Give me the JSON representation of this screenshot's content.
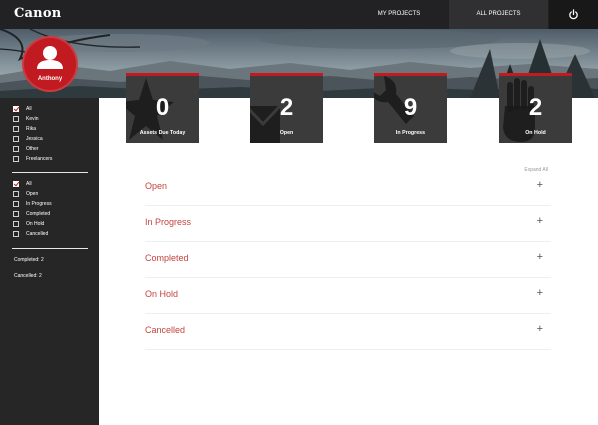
{
  "header": {
    "logo": "Canon",
    "nav": {
      "my_projects": "MY PROJECTS",
      "all_projects": "ALL PROJECTS"
    },
    "power_icon": "power-icon"
  },
  "user": {
    "name": "Anthony"
  },
  "sidebar": {
    "people_filters": [
      {
        "label": "All",
        "checked": true
      },
      {
        "label": "Kevin",
        "checked": false
      },
      {
        "label": "Rika",
        "checked": false
      },
      {
        "label": "Jessica",
        "checked": false
      },
      {
        "label": "Other",
        "checked": false
      },
      {
        "label": "Freelancers",
        "checked": false
      }
    ],
    "status_filters": [
      {
        "label": "All",
        "checked": true
      },
      {
        "label": "Open",
        "checked": false
      },
      {
        "label": "In Progress",
        "checked": false
      },
      {
        "label": "Completed",
        "checked": false
      },
      {
        "label": "On Hold",
        "checked": false
      },
      {
        "label": "Cancelled",
        "checked": false
      }
    ],
    "summary": {
      "completed": "Completed: 2",
      "cancelled": "Cancelled: 2"
    }
  },
  "stats": [
    {
      "value": "0",
      "label": "Assets Due Today",
      "icon": "star-icon"
    },
    {
      "value": "2",
      "label": "Open",
      "icon": "envelope-icon"
    },
    {
      "value": "9",
      "label": "In Progress",
      "icon": "wrench-icon"
    },
    {
      "value": "2",
      "label": "On Hold",
      "icon": "hand-icon"
    }
  ],
  "content": {
    "expand_all": "Expand All",
    "sections": [
      {
        "title": "Open",
        "toggle": "+"
      },
      {
        "title": "In Progress",
        "toggle": "+"
      },
      {
        "title": "Completed",
        "toggle": "+"
      },
      {
        "title": "On Hold",
        "toggle": "+"
      },
      {
        "title": "Cancelled",
        "toggle": "+"
      }
    ]
  },
  "colors": {
    "accent": "#c11a20",
    "section_title": "#c4443f",
    "sidebar_bg": "#262626",
    "topbar_bg": "#222224"
  }
}
